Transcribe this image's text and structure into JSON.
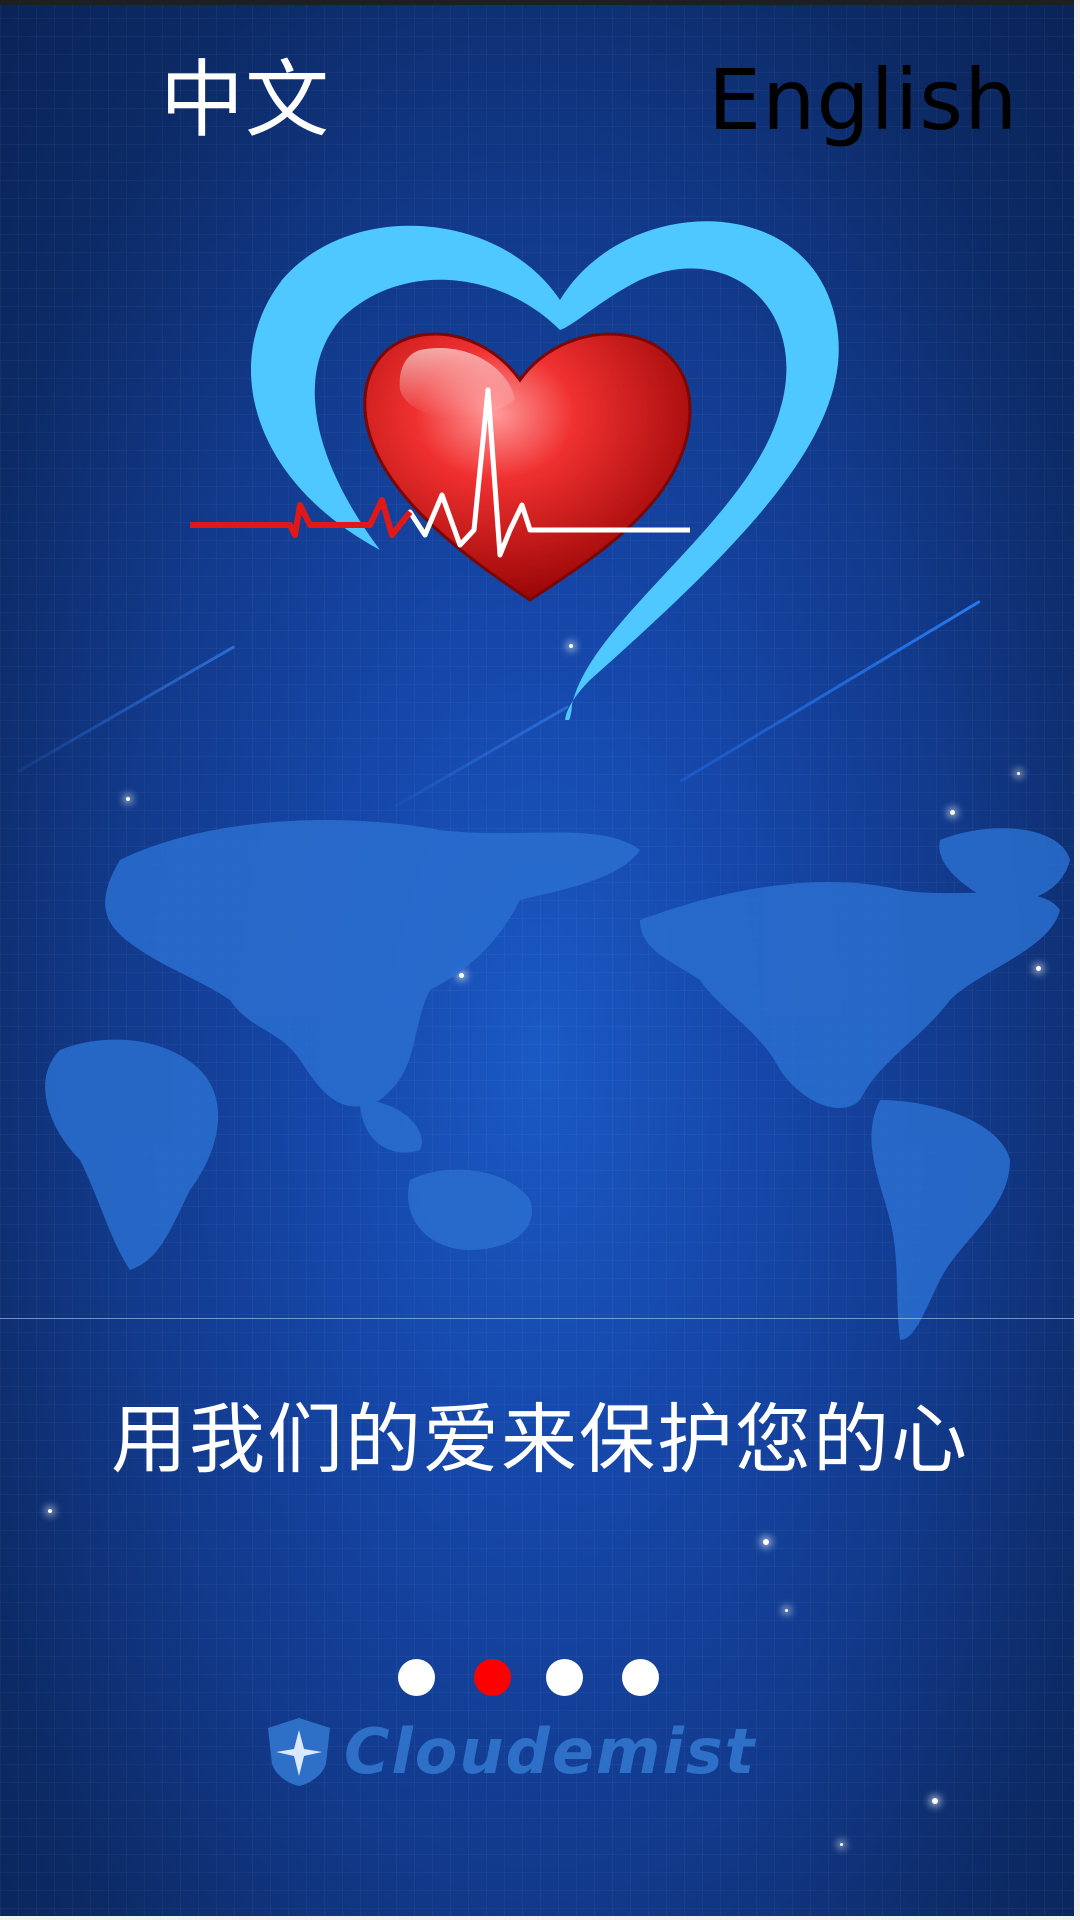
{
  "language_selector": {
    "chinese_label": "中文",
    "english_label": "English"
  },
  "slide": {
    "slogan": "用我们的爱来保护您的心"
  },
  "pager": {
    "total": 4,
    "active_index": 1,
    "active_color": "#ff0000",
    "inactive_color": "#ffffff"
  },
  "brand": {
    "name": "Cloudemist"
  },
  "colors": {
    "background": "#123a8c",
    "heart_outline": "#4fc8ff",
    "heart_fill": "#e01818",
    "map": "#2a6fd0"
  },
  "icons": {
    "logo": "heart-ecg-icon",
    "brand": "shield-compass-icon"
  }
}
